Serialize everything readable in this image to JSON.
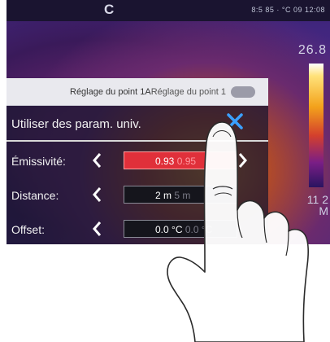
{
  "status_bar": {
    "left_glyph": "C",
    "text": "8:5 85 · °C 09 12:08"
  },
  "thermal": {
    "max_temp": "26.8",
    "min_temp": "11 2",
    "min_unit": "M"
  },
  "dialog": {
    "title": "Réglage du point 1A",
    "title_repeat": "Réglage du point 1",
    "use_universal_label": "Utiliser des param. univ.",
    "rows": [
      {
        "label": "Émissivité:",
        "value": "0.93",
        "ghost": "0.95"
      },
      {
        "label": "Distance:",
        "value": "2 m",
        "ghost": "5 m"
      },
      {
        "label": "Offset:",
        "value": "0.0 °C",
        "ghost": "0.0 °C"
      }
    ]
  },
  "colors": {
    "active_value": "#e0303a",
    "panel": "#16162e",
    "accent_close": "#3aa0ff"
  },
  "icons": [
    "close-icon",
    "chevron-left-icon",
    "chevron-right-icon",
    "pointing-hand-icon"
  ]
}
